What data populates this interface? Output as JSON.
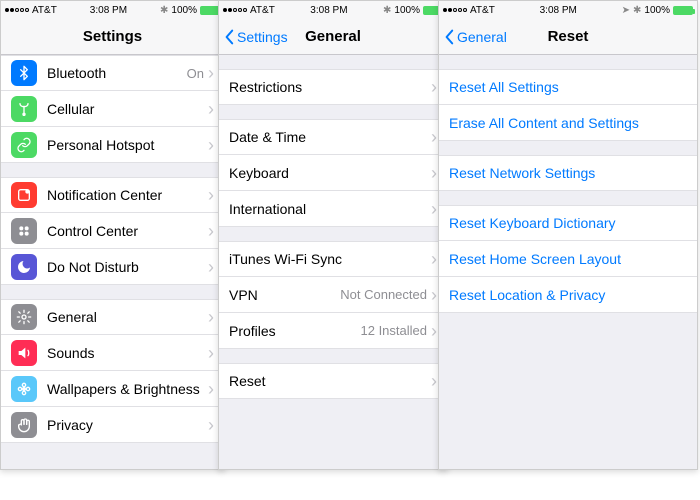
{
  "status1": {
    "carrier": "AT&T",
    "time": "3:08 PM",
    "batt": "100%"
  },
  "status2": {
    "carrier": "AT&T",
    "time": "3:08 PM",
    "batt": "100%"
  },
  "status3": {
    "carrier": "AT&T",
    "time": "3:08 PM",
    "batt": "100%"
  },
  "p1": {
    "title": "Settings",
    "rows": [
      {
        "label": "Bluetooth",
        "value": "On",
        "icon_bg": "#007aff",
        "glyph": "BT"
      },
      {
        "label": "Cellular",
        "icon_bg": "#4cd964",
        "glyph": "ANT"
      },
      {
        "label": "Personal Hotspot",
        "icon_bg": "#4cd964",
        "glyph": "LINK"
      }
    ],
    "rows2": [
      {
        "label": "Notification Center",
        "icon_bg": "#ff3b30",
        "glyph": "NOTIF"
      },
      {
        "label": "Control Center",
        "icon_bg": "#8e8e93",
        "glyph": "CTRL"
      },
      {
        "label": "Do Not Disturb",
        "icon_bg": "#5856d6",
        "glyph": "MOON"
      }
    ],
    "rows3": [
      {
        "label": "General",
        "icon_bg": "#8e8e93",
        "glyph": "GEAR"
      },
      {
        "label": "Sounds",
        "icon_bg": "#ff2d55",
        "glyph": "SPK"
      },
      {
        "label": "Wallpapers & Brightness",
        "icon_bg": "#5ac8fa",
        "glyph": "FLOWER"
      },
      {
        "label": "Privacy",
        "icon_bg": "#8e8e93",
        "glyph": "HAND"
      }
    ]
  },
  "p2": {
    "back": "Settings",
    "title": "General",
    "g1": [
      {
        "label": "Restrictions"
      }
    ],
    "g2": [
      {
        "label": "Date & Time"
      },
      {
        "label": "Keyboard"
      },
      {
        "label": "International"
      }
    ],
    "g3": [
      {
        "label": "iTunes Wi-Fi Sync"
      },
      {
        "label": "VPN",
        "value": "Not Connected"
      },
      {
        "label": "Profiles",
        "value": "12 Installed"
      }
    ],
    "g4": [
      {
        "label": "Reset"
      }
    ]
  },
  "p3": {
    "back": "General",
    "title": "Reset",
    "g1": [
      {
        "label": "Reset All Settings"
      },
      {
        "label": "Erase All Content and Settings"
      }
    ],
    "g2": [
      {
        "label": "Reset Network Settings"
      }
    ],
    "g3": [
      {
        "label": "Reset Keyboard Dictionary"
      },
      {
        "label": "Reset Home Screen Layout"
      },
      {
        "label": "Reset Location & Privacy"
      }
    ]
  }
}
